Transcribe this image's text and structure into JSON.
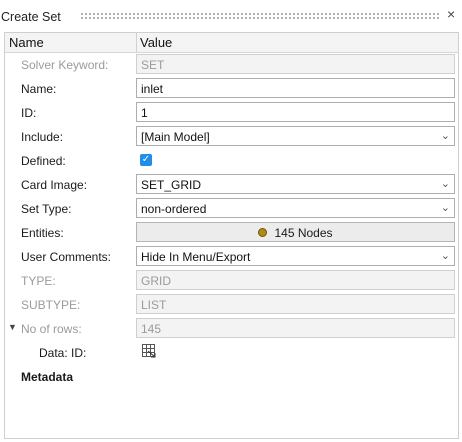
{
  "window": {
    "title": "Create Set",
    "close_glyph": "×"
  },
  "table": {
    "col_name": "Name",
    "col_value": "Value"
  },
  "rows": {
    "solver_keyword": {
      "label": "Solver Keyword:",
      "value": "SET"
    },
    "name": {
      "label": "Name:",
      "value": "inlet"
    },
    "id": {
      "label": "ID:",
      "value": "1"
    },
    "include": {
      "label": "Include:",
      "value": "[Main Model]"
    },
    "defined": {
      "label": "Defined:",
      "checked": true
    },
    "card_image": {
      "label": "Card Image:",
      "value": "SET_GRID"
    },
    "set_type": {
      "label": "Set Type:",
      "value": "non-ordered"
    },
    "entities": {
      "label": "Entities:",
      "value": "145 Nodes"
    },
    "user_comments": {
      "label": "User Comments:",
      "value": "Hide In Menu/Export"
    },
    "type": {
      "label": "TYPE:",
      "value": "GRID"
    },
    "subtype": {
      "label": "SUBTYPE:",
      "value": "LIST"
    },
    "no_of_rows": {
      "label": "No of rows:",
      "value": "145"
    },
    "data_id": {
      "label": "Data: ID:",
      "icon": "table-icon"
    },
    "metadata": {
      "label": "Metadata"
    }
  },
  "icons": {
    "dropdown": "chevron-down-icon",
    "entity": "node-dot-icon",
    "collapse": "collapse-arrow-icon"
  },
  "colors": {
    "checkbox": "#1e8ee8",
    "entity_dot": "#b38a18"
  }
}
